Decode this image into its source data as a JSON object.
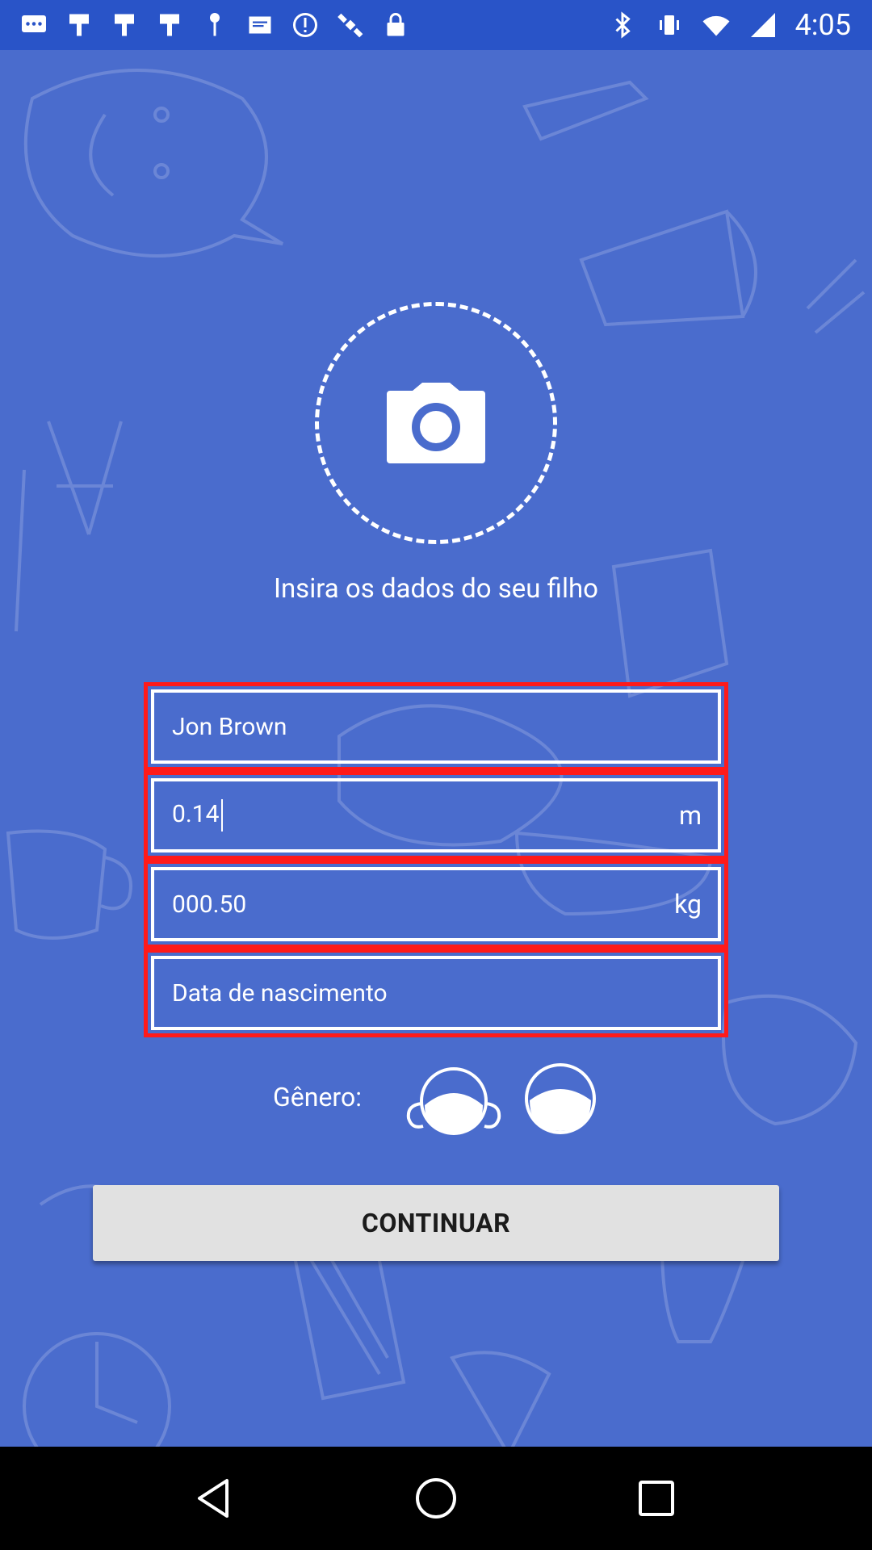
{
  "status_bar": {
    "time": "4:05",
    "left_icons": [
      "messages-icon",
      "flag-icon",
      "flag-icon",
      "flag-icon",
      "key-icon",
      "sim-icon",
      "alert-icon",
      "satellite-icon",
      "lock-icon"
    ],
    "right_icons": [
      "bluetooth-icon",
      "vibrate-icon",
      "wifi-icon",
      "signal-icon"
    ]
  },
  "form": {
    "instruction": "Insira os dados do seu filho",
    "name": {
      "value": "Jon Brown"
    },
    "height": {
      "value": "0.14",
      "unit": "m"
    },
    "weight": {
      "value": "000.50",
      "unit": "kg"
    },
    "birth": {
      "placeholder": "Data de nascimento"
    },
    "gender_label": "Gênero:",
    "gender_options": [
      "girl-icon",
      "boy-icon"
    ],
    "continue_label": "CONTINUAR"
  },
  "colors": {
    "background": "#4a6ccd",
    "status_bar": "#2954c8",
    "field_border_highlight": "#ff1a1a",
    "button": "#e1e1e1"
  }
}
